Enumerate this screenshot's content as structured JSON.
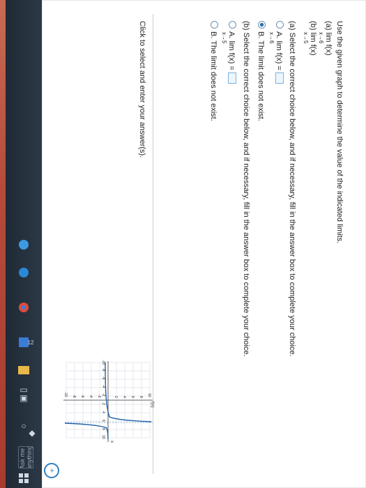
{
  "taskbar": {
    "search_placeholder": "Ask me anything",
    "badge": "12",
    "icons": [
      "windows-icon",
      "search-icon",
      "task-view-icon",
      "file-explorer-icon",
      "store-icon",
      "edge-icon",
      "chrome-icon",
      "ie-icon",
      "photos-icon",
      "settings-icon"
    ]
  },
  "question": {
    "prompt": "Use the given graph to determine the value of the indicated limits.",
    "a_label": "(a)  lim  f(x)",
    "a_sub": "x→6",
    "b_label": "(b)  lim  f(x)",
    "b_sub": "x→5",
    "part_a_instr": "(a) Select the correct choice below, and if necessary, fill in the answer box to complete your choice.",
    "a_choice_a": "A.  lim  f(x) =",
    "a_choice_a_sub": "x→6",
    "a_choice_b": "B.  The limit does not exist.",
    "part_b_instr": "(b) Select the correct choice below, and if necessary, fill in the answer box to complete your choice.",
    "b_choice_a": "A.  lim  f(x) =",
    "b_choice_a_sub": "x→5",
    "b_choice_b": "B.  The limit does not exist.",
    "footer": "Click to select and enter your answer(s)."
  },
  "graph": {
    "y_label": "f(x)",
    "x_label": "x",
    "x_ticks": [
      "-10",
      "-8",
      "-6",
      "-4",
      "-2",
      "2",
      "4",
      "6",
      "8",
      "10"
    ],
    "y_ticks": [
      "10",
      "8",
      "6",
      "4",
      "2",
      "-2",
      "-4",
      "-6",
      "-8",
      "-10"
    ]
  }
}
